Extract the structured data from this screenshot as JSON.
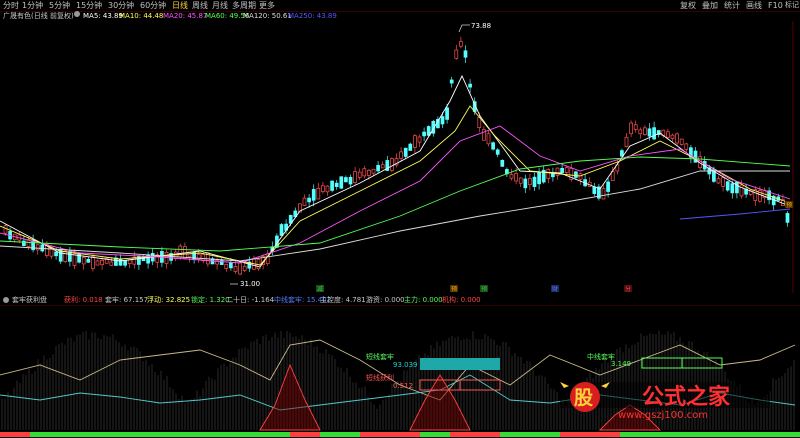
{
  "top_bar": {
    "periods": [
      "分时",
      "1分钟",
      "5分钟",
      "15分钟",
      "30分钟",
      "60分钟",
      "日线",
      "周线",
      "月线",
      "多周期",
      "更多"
    ],
    "active_period": "日线",
    "right_tools": [
      "复权",
      "叠加",
      "统计",
      "画线",
      "F10",
      "标记"
    ]
  },
  "main_info": {
    "stock": "广晟有色(日线 前复权)",
    "ma5": "MA5: 43.89",
    "ma10": "MA10: 44.48",
    "ma20": "MA20: 45.87",
    "ma60": "MA60: 49.56",
    "ma120": "MA120: 50.61",
    "ma250": "MA250: 43.89",
    "colors": {
      "ma5": "#ffffff",
      "ma10": "#ffff55",
      "ma20": "#ff55ff",
      "ma60": "#55ff55",
      "ma120": "#dddddd",
      "ma250": "#5555ff"
    }
  },
  "main_chart": {
    "high_label": "73.88",
    "low_label": "31.00",
    "event_markers": [
      {
        "label": "减",
        "color": "#33cc33"
      },
      {
        "label": "预",
        "color": "#ffaa00"
      },
      {
        "label": "预",
        "color": "#33cc33"
      },
      {
        "label": "财",
        "color": "#5577ff"
      },
      {
        "label": "分",
        "color": "#ff4444"
      },
      {
        "label": "预",
        "color": "#ffaa00"
      }
    ]
  },
  "sub_info": {
    "title": "套牢获利盘",
    "items": [
      {
        "label": "获利: 0.018",
        "color": "#ff4444"
      },
      {
        "label": "套牢: 67.157",
        "color": "#c8c8c8"
      },
      {
        "label": "浮动: 32.825",
        "color": "#ffff55"
      },
      {
        "label": "锁定: 1.320",
        "color": "#55ff55"
      },
      {
        "label": "二十日: -1.164",
        "color": "#c8c8c8"
      },
      {
        "label": "中线套牢: 15.402",
        "color": "#5577ff"
      },
      {
        "label": "主控度: 4.781",
        "color": "#c8c8c8"
      },
      {
        "label": "游资: 0.000",
        "color": "#c8c8c8"
      },
      {
        "label": "主力: 0.000",
        "color": "#55ff55"
      },
      {
        "label": "机构: 0.000",
        "color": "#ff4444"
      }
    ]
  },
  "sub_chart": {
    "short_trapped_label": "短线套牢",
    "short_trapped_value": "93.039",
    "short_profit_label": "短线获利",
    "short_profit_value": "0.512",
    "mid_trapped_label": "中线套牢",
    "mid_trapped_value": "3.149"
  },
  "watermark": {
    "logo_char": "股",
    "text": "公式之家",
    "url": "www.gszj100.com"
  }
}
